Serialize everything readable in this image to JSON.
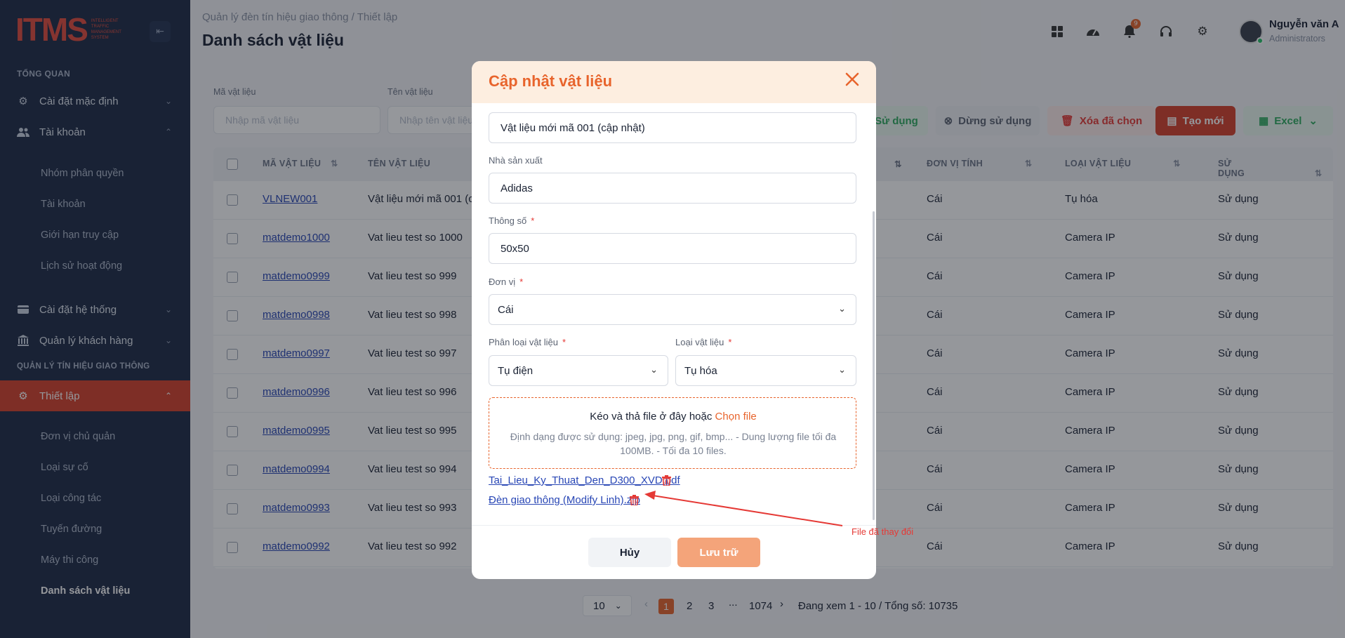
{
  "brand": {
    "logo_text": "ITMS",
    "tagline": "INTELLIGENT TRAFFIC MANAGEMENT SYSTEM"
  },
  "sidebar": {
    "section_overview": "TỔNG QUAN",
    "items": [
      {
        "label": "Cài đặt mặc định",
        "icon": "gear-icon"
      },
      {
        "label": "Tài khoản",
        "icon": "users-icon"
      },
      {
        "label": "Cài đặt hệ thống",
        "icon": "card-icon"
      },
      {
        "label": "Quản lý khách hàng",
        "icon": "bank-icon"
      },
      {
        "label": "Thiết lập",
        "icon": "settings-icon"
      }
    ],
    "account_sub": [
      "Nhóm phân quyền",
      "Tài khoản",
      "Giới hạn truy cập",
      "Lịch sử hoạt động"
    ],
    "section_traffic": "QUẢN LÝ TÍN HIỆU GIAO THÔNG",
    "setup_sub": [
      "Đơn vị chủ quản",
      "Loại sự cố",
      "Loại công tác",
      "Tuyến đường",
      "Máy thi công",
      "Danh sách vật liệu"
    ]
  },
  "header": {
    "breadcrumb": "Quản lý đèn tín hiệu giao thông  /  Thiết lập",
    "title": "Danh sách vật liệu",
    "notification_count": "9",
    "user_name": "Nguyễn văn A",
    "user_role": "Administrators"
  },
  "filters": {
    "code_label": "Mã vật liệu",
    "code_placeholder": "Nhập mã vật liệu",
    "name_label": "Tên vật liệu",
    "name_placeholder": "Nhập tên vật liệu"
  },
  "toolbar": {
    "use_label": "Sử dụng",
    "stop_label": "Dừng sử dụng",
    "delete_label": "Xóa đã chọn",
    "create_label": "Tạo mới",
    "excel_label": "Excel"
  },
  "table": {
    "headers": [
      "MÃ VẬT LIỆU",
      "TÊN VẬT LIỆU",
      "ĐƠN VỊ TÍNH",
      "LOẠI VẬT LIỆU",
      "SỬ DỤNG"
    ],
    "rows": [
      {
        "code": "VLNEW001",
        "name": "Vật liệu mới mã 001 (c",
        "unit": "Cái",
        "type": "Tụ hóa",
        "use": "Sử dụng"
      },
      {
        "code": "matdemo1000",
        "name": "Vat lieu test so 1000",
        "unit": "Cái",
        "type": "Camera IP",
        "use": "Sử dụng"
      },
      {
        "code": "matdemo0999",
        "name": "Vat lieu test so 999",
        "unit": "Cái",
        "type": "Camera IP",
        "use": "Sử dụng"
      },
      {
        "code": "matdemo0998",
        "name": "Vat lieu test so 998",
        "unit": "Cái",
        "type": "Camera IP",
        "use": "Sử dụng"
      },
      {
        "code": "matdemo0997",
        "name": "Vat lieu test so 997",
        "unit": "Cái",
        "type": "Camera IP",
        "use": "Sử dụng"
      },
      {
        "code": "matdemo0996",
        "name": "Vat lieu test so 996",
        "unit": "Cái",
        "type": "Camera IP",
        "use": "Sử dụng"
      },
      {
        "code": "matdemo0995",
        "name": "Vat lieu test so 995",
        "unit": "Cái",
        "type": "Camera IP",
        "use": "Sử dụng"
      },
      {
        "code": "matdemo0994",
        "name": "Vat lieu test so 994",
        "unit": "Cái",
        "type": "Camera IP",
        "use": "Sử dụng"
      },
      {
        "code": "matdemo0993",
        "name": "Vat lieu test so 993",
        "unit": "Cái",
        "type": "Camera IP",
        "use": "Sử dụng"
      },
      {
        "code": "matdemo0992",
        "name": "Vat lieu test so 992",
        "unit": "Cái",
        "type": "Camera IP",
        "use": "Sử dụng"
      }
    ]
  },
  "pagination": {
    "page_size": "10",
    "pages": [
      "1",
      "2",
      "3",
      "...",
      "1074"
    ],
    "current": "1",
    "summary": "Đang xem 1 - 10 / Tổng số: 10735"
  },
  "modal": {
    "title": "Cập nhật vật liệu",
    "name_value": "Vật liệu mới mã 001 (cập nhật)",
    "manufacturer_label": "Nhà sản xuất",
    "manufacturer_value": "Adidas",
    "spec_label": "Thông số",
    "spec_value": "50x50",
    "unit_label": "Đơn vị",
    "unit_value": "Cái",
    "category_label": "Phân loại vật liệu",
    "category_value": "Tụ điện",
    "type_label": "Loại vật liệu",
    "type_value": "Tụ hóa",
    "required_mark": "*",
    "dropzone_text": "Kéo và thả file ở đây hoặc",
    "dropzone_pick": "Chọn file",
    "dropzone_hint": "Định dạng được sử dụng: jpeg, jpg, png, gif, bmp... - Dung lượng file tối đa 100MB. - Tối đa 10 files.",
    "files": [
      "Tai_Lieu_Ky_Thuat_Den_D300_XVD.pdf",
      "Đèn giao thông (Modify Linh).zip"
    ],
    "cancel_label": "Hủy",
    "save_label": "Lưu trữ"
  },
  "annotation": {
    "text": "File đã thay đổi",
    "color": "#e53935"
  },
  "colors": {
    "accent": "#e8642c",
    "sidebar_bg": "#1e2a45",
    "active_nav": "#d5402b"
  }
}
